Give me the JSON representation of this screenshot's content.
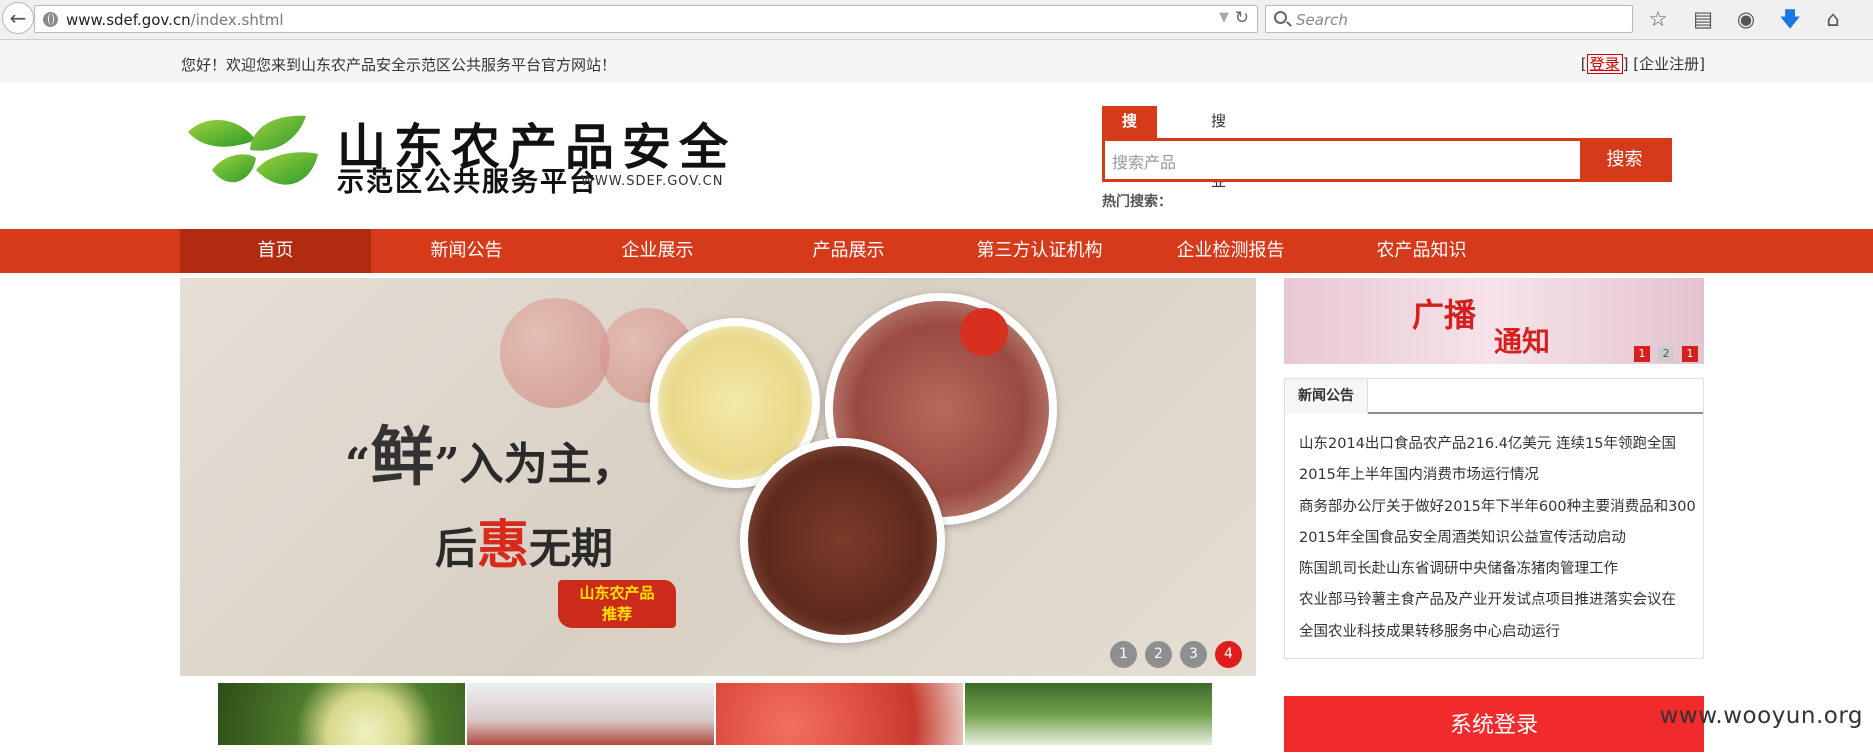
{
  "browser": {
    "url_host": "www.sdef.gov.cn",
    "url_path": "/index.shtml",
    "search_placeholder": "Search"
  },
  "topbar": {
    "welcome": "您好！欢迎您来到山东农产品安全示范区公共服务平台官方网站！",
    "bracket_open": "[",
    "login": "登录",
    "middle": "] [",
    "register": "企业注册",
    "bracket_close": "]"
  },
  "header": {
    "title": "山东农产品安全",
    "subtitle": "示范区公共服务平台",
    "site_url": "WWW.SDEF.GOV.CN"
  },
  "search": {
    "tabs": [
      "搜产品",
      "搜企业"
    ],
    "active_tab": 0,
    "placeholder": "搜索产品",
    "button": "搜索",
    "hot_label": "热门搜索："
  },
  "nav": {
    "items": [
      "首页",
      "新闻公告",
      "企业展示",
      "产品展示",
      "第三方认证机构",
      "企业检测报告",
      "农产品知识"
    ],
    "active": 0
  },
  "banner": {
    "slogan_quote_open": "“",
    "slogan_char": "鲜",
    "slogan_rest": "”入为主，",
    "slogan2_a": "后",
    "slogan2_red": "惠",
    "slogan2_b": "无期",
    "badge_line1": "山东农产品",
    "badge_line2": "推荐",
    "dots": [
      "1",
      "2",
      "3",
      "4"
    ],
    "active_dot": 3
  },
  "broadcast": {
    "text1": "广播",
    "text2": "通知",
    "pager": [
      "1",
      "2",
      "1"
    ]
  },
  "news": {
    "tab": "新闻公告",
    "items": [
      "山东2014出口食品农产品216.4亿美元 连续15年领跑全国",
      "2015年上半年国内消费市场运行情况",
      "商务部办公厅关于做好2015年下半年600种主要消费品和300",
      "2015年全国食品安全周酒类知识公益宣传活动启动",
      "陈国凯司长赴山东省调研中央储备冻猪肉管理工作",
      "农业部马铃薯主食产品及产业开发试点项目推进落实会议在",
      "全国农业科技成果转移服务中心启动运行"
    ]
  },
  "sys_login": "系统登录",
  "watermark": "www.wooyun.org",
  "colors": {
    "brand_red": "#d53a1a",
    "nav_active": "#b02b0f",
    "login_button": "#f12b2b"
  }
}
